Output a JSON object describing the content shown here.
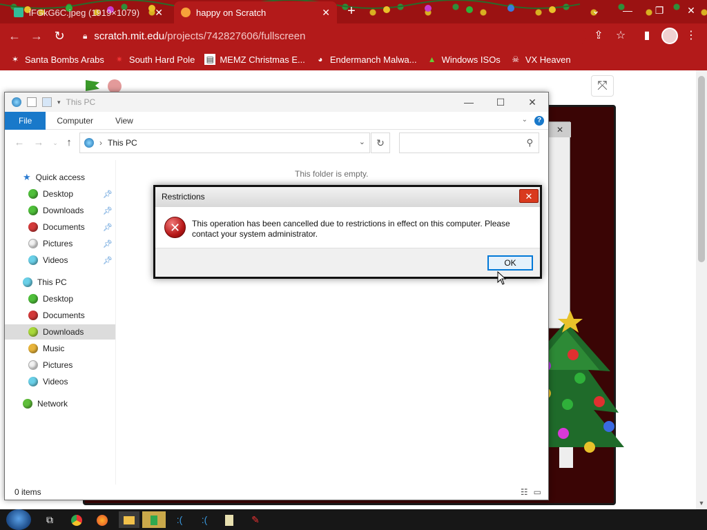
{
  "browser": {
    "tabs": [
      {
        "title": "iFGkG6C.jpeg (1919×1079)",
        "active": false
      },
      {
        "title": "happy on Scratch",
        "active": true
      }
    ],
    "new_tab_label": "+",
    "window_buttons": {
      "minimize": "—",
      "restore": "❐",
      "close": "✕",
      "dropdown": "⌄"
    },
    "url": {
      "host": "scratch.mit.edu",
      "path": "/projects/742827606/fullscreen"
    },
    "bookmarks": [
      {
        "label": "Santa Bombs Arabs",
        "icon": "santa-icon"
      },
      {
        "label": "South Hard Pole",
        "icon": "star-icon"
      },
      {
        "label": "MEMZ Christmas E...",
        "icon": "page-icon"
      },
      {
        "label": "Endermanch Malwa...",
        "icon": "raccoon-icon"
      },
      {
        "label": "Windows ISOs",
        "icon": "tree-icon"
      },
      {
        "label": "VX Heaven",
        "icon": "skull-icon"
      }
    ],
    "accent_color": "#b31a1a"
  },
  "scratch": {
    "fullscreen_icon": "exit-fullscreen-icon",
    "green_flag_color": "#3a9a2a",
    "stop_color": "#e39a9a"
  },
  "explorer": {
    "title": "This PC",
    "ribbon_tabs": [
      "File",
      "Computer",
      "View"
    ],
    "address": "This PC",
    "empty_message": "This folder is empty.",
    "status": "0 items",
    "nav": {
      "quick_access": "Quick access",
      "quick_items": [
        "Desktop",
        "Downloads",
        "Documents",
        "Pictures",
        "Videos"
      ],
      "this_pc": "This PC",
      "pc_items": [
        "Desktop",
        "Documents",
        "Downloads",
        "Music",
        "Pictures",
        "Videos"
      ],
      "selected": "Downloads",
      "network": "Network"
    }
  },
  "dialog": {
    "title": "Restrictions",
    "close_label": "✕",
    "icon": "error-icon",
    "message": "This operation has been cancelled due to restrictions in effect on this computer. Please contact your system administrator.",
    "ok_label": "OK"
  },
  "taskbar": {
    "icons": [
      "start-orb-icon",
      "task-view-icon",
      "chrome-icon",
      "firefox-icon",
      "file-explorer-icon",
      "scratch-icon",
      "terminal-icon",
      "terminal-icon-2",
      "notepad-icon",
      "paint-icon"
    ]
  }
}
